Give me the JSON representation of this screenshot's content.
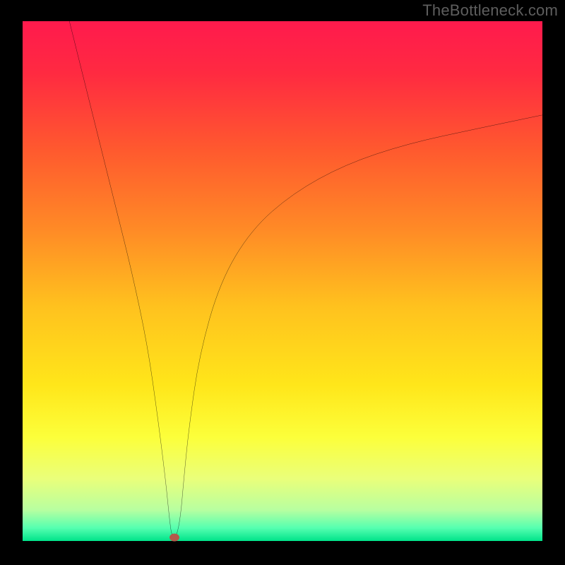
{
  "watermark": "TheBottleneck.com",
  "chart_data": {
    "type": "line",
    "title": "",
    "xlabel": "",
    "ylabel": "",
    "xlim": [
      0,
      100
    ],
    "ylim": [
      0,
      100
    ],
    "gradient_stops": [
      {
        "offset": 0,
        "color": "#ff1a4d"
      },
      {
        "offset": 0.1,
        "color": "#ff2a41"
      },
      {
        "offset": 0.25,
        "color": "#ff5a2e"
      },
      {
        "offset": 0.4,
        "color": "#ff8a26"
      },
      {
        "offset": 0.55,
        "color": "#ffc21e"
      },
      {
        "offset": 0.7,
        "color": "#ffe61a"
      },
      {
        "offset": 0.8,
        "color": "#fcff3a"
      },
      {
        "offset": 0.88,
        "color": "#eaff7a"
      },
      {
        "offset": 0.94,
        "color": "#b8ffa0"
      },
      {
        "offset": 0.975,
        "color": "#55ffb0"
      },
      {
        "offset": 1.0,
        "color": "#00e38a"
      }
    ],
    "series": [
      {
        "name": "curve",
        "x": [
          9,
          12,
          15,
          18,
          21,
          24,
          26,
          27.5,
          28.2,
          28.7,
          29.6,
          30.4,
          31,
          32,
          34,
          38,
          44,
          52,
          62,
          74,
          88,
          100
        ],
        "y": [
          100,
          88,
          76,
          64,
          52,
          38,
          24,
          12,
          5,
          1,
          1,
          5,
          12,
          22,
          36,
          50,
          60,
          67,
          72.5,
          76.5,
          79.5,
          82
        ]
      }
    ],
    "marker": {
      "x": 29.2,
      "y": 0.9,
      "color": "#b35a4a"
    }
  }
}
